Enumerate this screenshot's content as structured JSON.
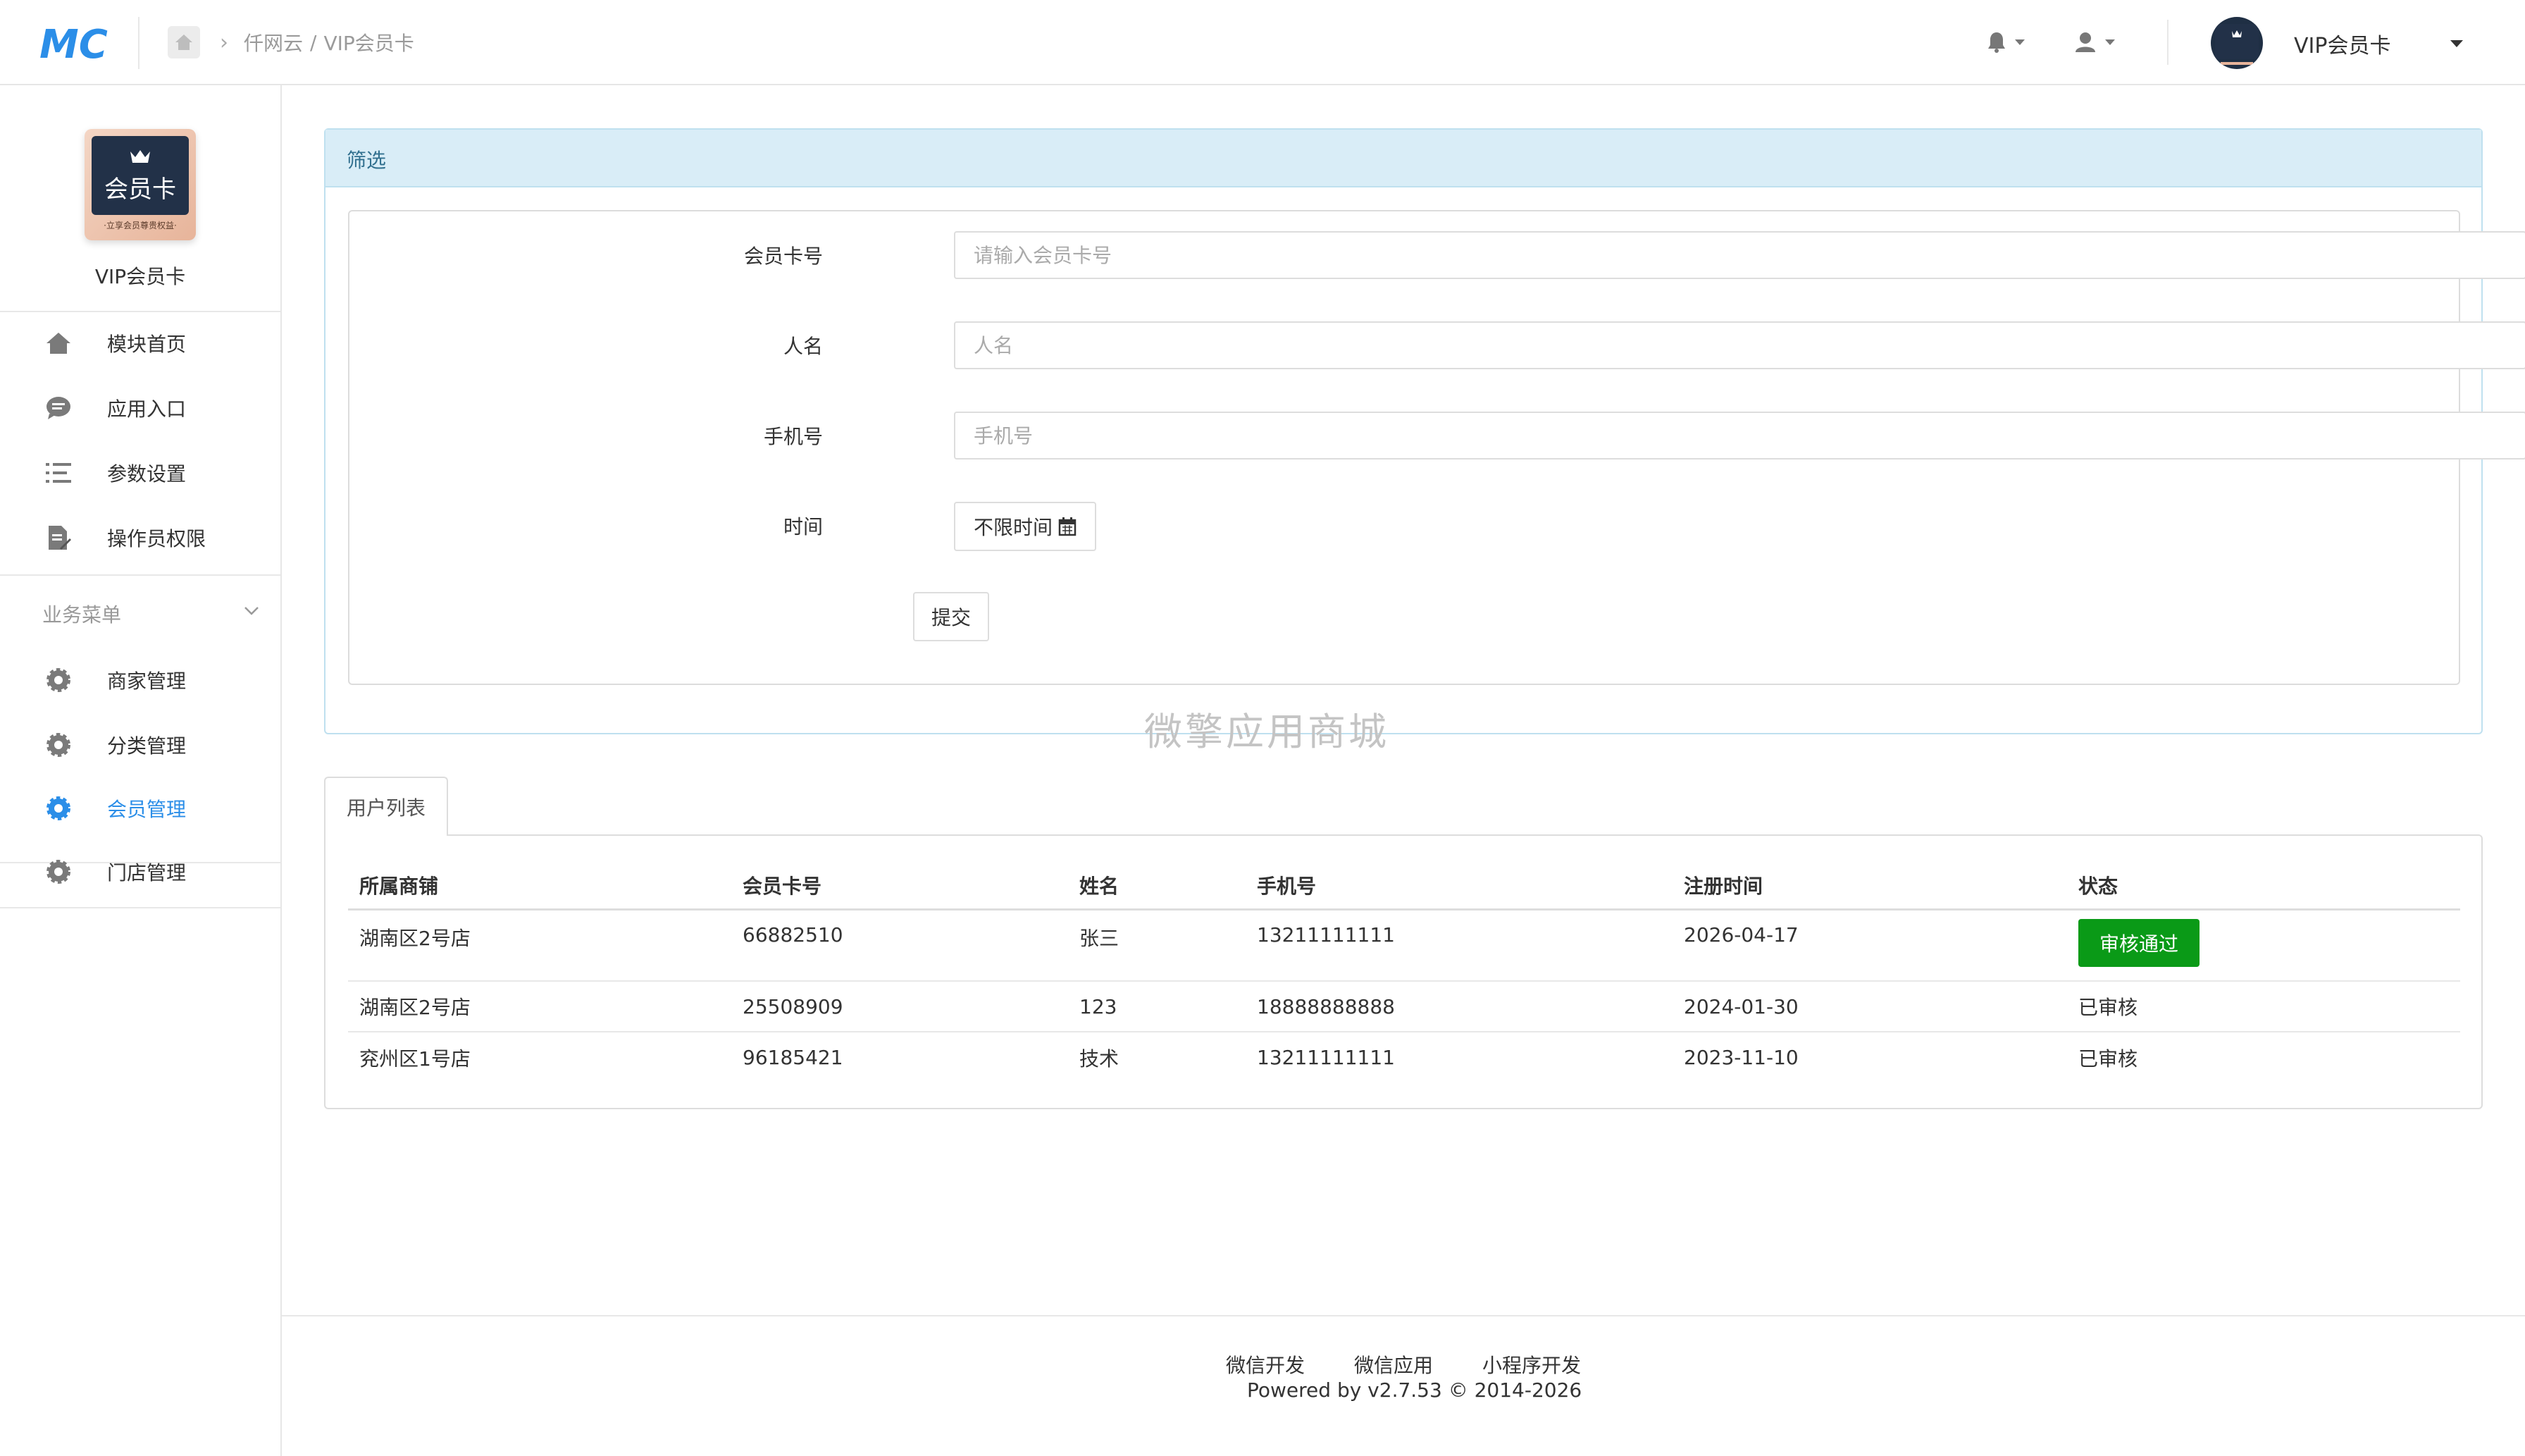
{
  "header": {
    "logo_text": "MC",
    "breadcrumb": [
      "仟网云",
      "VIP会员卡"
    ],
    "breadcrumb_sep": "/",
    "app_selector": "VIP会员卡"
  },
  "sidebar": {
    "app_card_text": "会员卡",
    "app_card_sub": "·立享会员尊贵权益·",
    "app_name": "VIP会员卡",
    "items": [
      {
        "label": "模块首页",
        "icon": "home-icon"
      },
      {
        "label": "应用入口",
        "icon": "chat-icon"
      },
      {
        "label": "参数设置",
        "icon": "list-icon"
      },
      {
        "label": "操作员权限",
        "icon": "document-edit-icon"
      }
    ],
    "group_title": "业务菜单",
    "business_items": [
      {
        "label": "商家管理",
        "icon": "gear-icon",
        "active": false
      },
      {
        "label": "分类管理",
        "icon": "gear-icon",
        "active": false
      },
      {
        "label": "会员管理",
        "icon": "gear-icon",
        "active": true
      },
      {
        "label": "门店管理",
        "icon": "gear-icon",
        "active": false
      }
    ],
    "active_color": "#2b8ee8"
  },
  "filter": {
    "title": "筛选",
    "fields": [
      {
        "label": "会员卡号",
        "placeholder": "请输入会员卡号",
        "value": ""
      },
      {
        "label": "人名",
        "placeholder": "人名",
        "value": ""
      },
      {
        "label": "手机号",
        "placeholder": "手机号",
        "value": ""
      }
    ],
    "time_label": "时间",
    "time_value": "不限时间",
    "submit_label": "提交"
  },
  "watermark": "微擎应用商城",
  "table": {
    "tab_label": "用户列表",
    "columns": [
      "所属商铺",
      "会员卡号",
      "姓名",
      "手机号",
      "注册时间",
      "状态"
    ],
    "rows": [
      {
        "shop": "湖南区2号店",
        "card": "66882510",
        "name": "张三",
        "phone": "13211111111",
        "date": "2026-04-17",
        "status": "审核通过",
        "status_type": "button"
      },
      {
        "shop": "湖南区2号店",
        "card": "25508909",
        "name": "123",
        "phone": "18888888888",
        "date": "2024-01-30",
        "status": "已审核",
        "status_type": "text"
      },
      {
        "shop": "兖州区1号店",
        "card": "96185421",
        "name": "技术",
        "phone": "13211111111",
        "date": "2023-11-10",
        "status": "已审核",
        "status_type": "text"
      }
    ],
    "approve_color": "#0a9a17"
  },
  "footer": {
    "links": [
      "微信开发",
      "微信应用",
      "小程序开发"
    ],
    "powered": "Powered by v2.7.53 © 2014-2026"
  }
}
